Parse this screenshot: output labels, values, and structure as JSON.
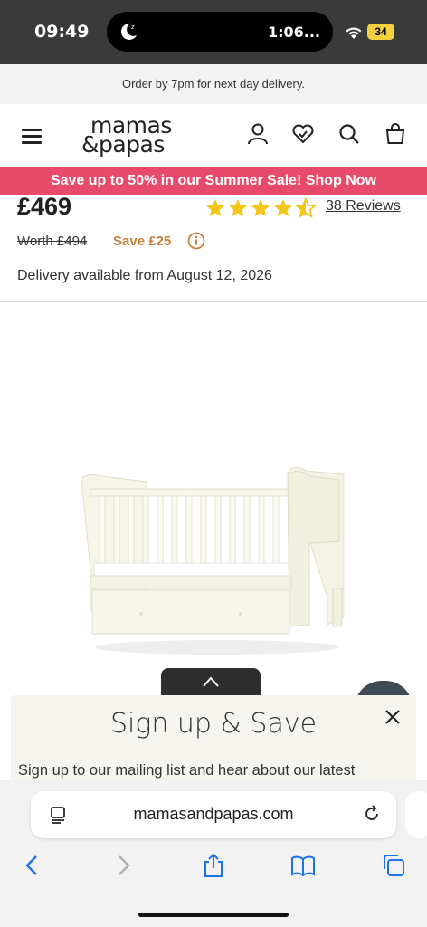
{
  "status_bar": {
    "time": "09:49",
    "activity_text": "1:06...",
    "battery": "34",
    "colors": {
      "battery": "#f4d03f"
    }
  },
  "delivery_strip": {
    "text": "Order by 7pm for next day delivery."
  },
  "header": {
    "logo_line1": "mamas",
    "logo_line2": "&papas",
    "icons": [
      "menu-icon",
      "account-icon",
      "wishlist-icon",
      "search-icon",
      "bag-icon"
    ]
  },
  "promo": {
    "text": "Save up to 50% in our Summer Sale! Shop Now",
    "color": "#e84a6a"
  },
  "product": {
    "price": "£469",
    "rating": 4.5,
    "reviews": "38 Reviews",
    "worth": "Worth £494",
    "save": "Save £25",
    "delivery": "Delivery available from August 12, 2026",
    "colors": {
      "star": "#f5c518",
      "save": "#c8803a"
    }
  },
  "signup": {
    "title": "Sign up & Save",
    "text": "Sign up to our mailing list and hear about our latest"
  },
  "browser": {
    "url": "mamasandpapas.com"
  }
}
